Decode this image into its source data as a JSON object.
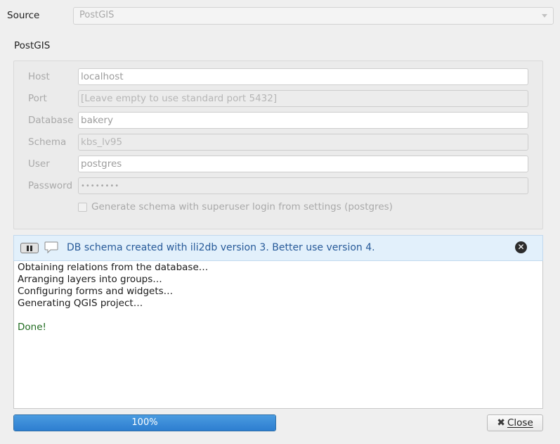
{
  "source": {
    "label": "Source",
    "selected": "PostGIS"
  },
  "postgis": {
    "title": "PostGIS",
    "fields": {
      "host": {
        "label": "Host",
        "value": "localhost"
      },
      "port": {
        "label": "Port",
        "placeholder": "[Leave empty to use standard port 5432]"
      },
      "database": {
        "label": "Database",
        "value": "bakery"
      },
      "schema": {
        "label": "Schema",
        "value": "kbs_lv95"
      },
      "user": {
        "label": "User",
        "value": "postgres"
      },
      "password": {
        "label": "Password",
        "value": "••••••••"
      }
    },
    "superuser_checkbox": {
      "label": "Generate schema with superuser login from settings (postgres)",
      "checked": false
    }
  },
  "message_bar": {
    "text": "DB schema created with ili2db version 3. Better use version 4.",
    "icons": [
      "pause-icon",
      "speech-bubble-icon",
      "close-icon"
    ]
  },
  "log": {
    "lines": [
      "Obtaining relations from the database…",
      "Arranging layers into groups…",
      "Configuring forms and widgets…",
      "Generating QGIS project…"
    ],
    "done": "Done!",
    "done_color": "#1f6b1f"
  },
  "progress": {
    "value": 100,
    "text": "100%"
  },
  "close_button": {
    "label": "Close",
    "icon": "x-icon"
  },
  "colors": {
    "accent": "#2d7ed0",
    "message_text": "#275a99",
    "message_bg": "#e2f0fb"
  }
}
